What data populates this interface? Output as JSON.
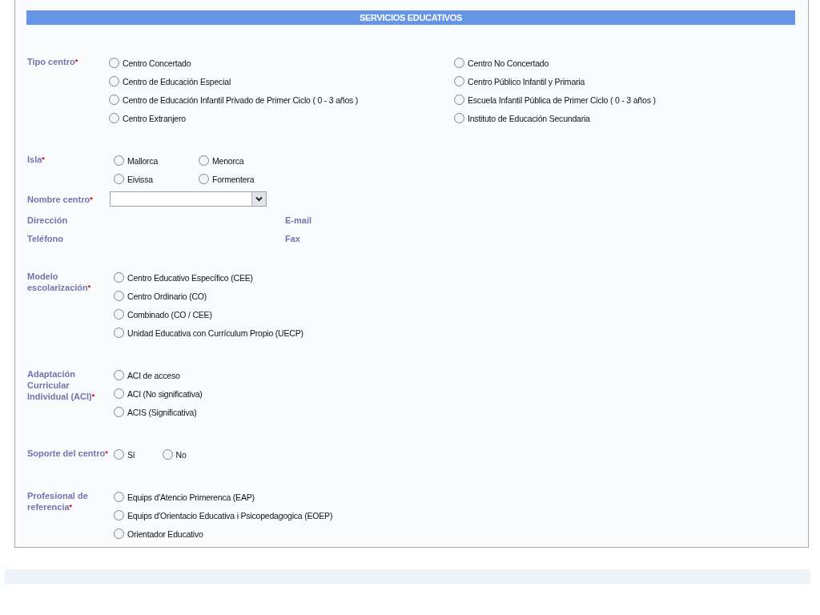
{
  "header": {
    "title": "SERVICIOS EDUCATIVOS"
  },
  "sections": [
    {
      "kind": "radio_columns",
      "label": "Tipo centro",
      "required_mark": "*",
      "columns": [
        [
          {
            "label": "Centro Concertado",
            "selected": false
          },
          {
            "label": "Centro de Educación Especial",
            "selected": false
          },
          {
            "label": "Centro de Educación Infantil Privado de Primer Ciclo ( 0 - 3 años )",
            "selected": false
          },
          {
            "label": "Centro Extranjero",
            "selected": false
          }
        ],
        [
          {
            "label": "Centro No Concertado",
            "selected": false
          },
          {
            "label": "Centro Público Infantil y Primaria",
            "selected": false
          },
          {
            "label": "Escuela Infantil Pública de Primer Ciclo ( 0 - 3 años )",
            "selected": false
          },
          {
            "label": "Instituto de Educación Secundaria",
            "selected": false
          }
        ]
      ]
    },
    {
      "kind": "radio_grid",
      "label": "Isla",
      "required_mark": "*",
      "options": [
        {
          "label": "Mallorca",
          "selected": false
        },
        {
          "label": "Menorca",
          "selected": false
        },
        {
          "label": "Eivissa",
          "selected": false
        },
        {
          "label": "Formentera",
          "selected": false
        }
      ]
    },
    {
      "kind": "select",
      "label": "Nombre centro",
      "required_mark": "*"
    },
    {
      "kind": "info_pair",
      "fields": [
        {
          "label": "Dirección"
        },
        {
          "label": "E-mail"
        }
      ]
    },
    {
      "kind": "info_pair",
      "fields": [
        {
          "label": "Teléfono"
        },
        {
          "label": "Fax"
        }
      ]
    },
    {
      "kind": "radio_list",
      "label": "Modelo escolarización",
      "required_mark": "*",
      "options": [
        {
          "label": "Centro Educativo Específico (CEE)",
          "selected": false
        },
        {
          "label": "Centro Ordinario (CO)",
          "selected": false
        },
        {
          "label": "Combinado (CO / CEE)",
          "selected": false
        },
        {
          "label": "Unidad Educativa con Currículum Propio (UECP)",
          "selected": false
        }
      ]
    },
    {
      "kind": "radio_list",
      "label": "Adaptación Curricular Individual (ACI)",
      "required_mark": "*",
      "options": [
        {
          "label": "ACI de acceso",
          "selected": false
        },
        {
          "label": "ACI (No significativa)",
          "selected": false
        },
        {
          "label": "ACIS (Significativa)",
          "selected": false
        }
      ]
    },
    {
      "kind": "radio_row",
      "label": "Soporte del centro",
      "required_mark": "*",
      "options": [
        {
          "label": "Sí",
          "selected": false
        },
        {
          "label": "No",
          "selected": false
        }
      ]
    },
    {
      "kind": "radio_list",
      "label": "Profesional de referencia",
      "required_mark": "*",
      "options": [
        {
          "label": "Equips d'Atencio Primerenca (EAP)",
          "selected": false
        },
        {
          "label": "Equips d'Orientacio Educativa i Psicopedagogica (EOEP)",
          "selected": false
        },
        {
          "label": "Orientador Educativo",
          "selected": false
        }
      ]
    }
  ]
}
